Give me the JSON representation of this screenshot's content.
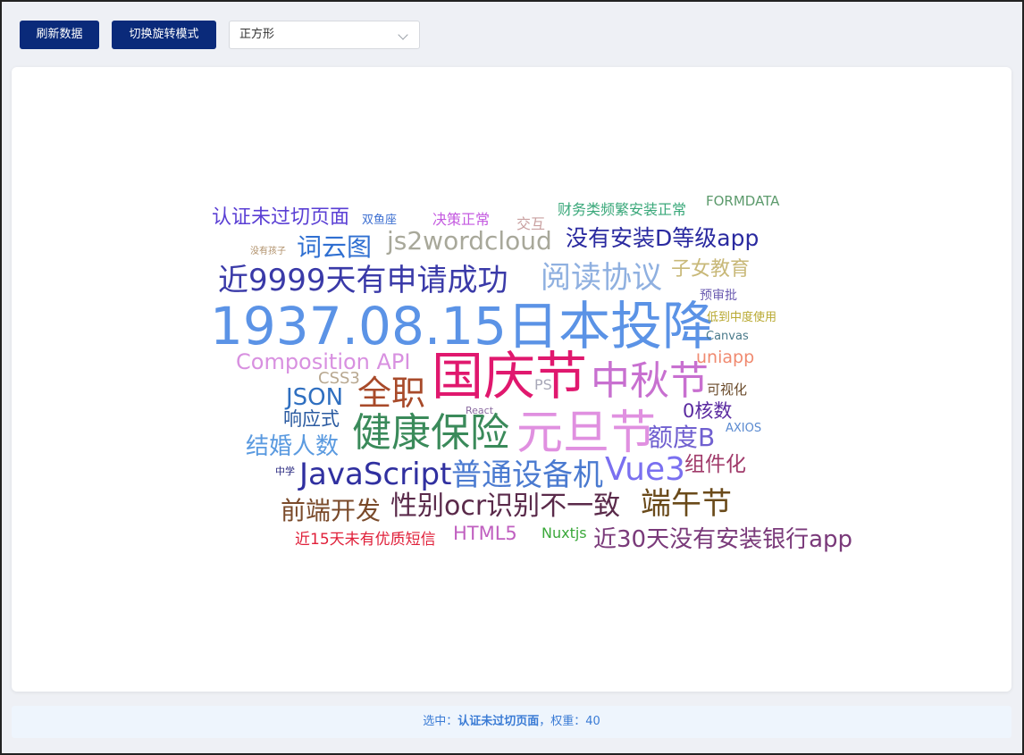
{
  "toolbar": {
    "refresh_label": "刷新数据",
    "rotate_label": "切换旋转模式",
    "shape_select_value": "正方形"
  },
  "status": {
    "prefix": "选中：",
    "selected_word": "认证未过切页面",
    "sep": "，权重：",
    "weight": "40"
  },
  "wordcloud": {
    "words": [
      {
        "text": "认证未过切页面",
        "color": "#5a3fd4"
      },
      {
        "text": "双鱼座",
        "color": "#3d6fd1"
      },
      {
        "text": "决策正常",
        "color": "#c45ae0"
      },
      {
        "text": "交互",
        "color": "#c9a0a0"
      },
      {
        "text": "财务类频繁安装正常",
        "color": "#3aa87a"
      },
      {
        "text": "FORMDATA",
        "color": "#5c9a6c"
      },
      {
        "text": "没有孩子",
        "color": "#b0906a"
      },
      {
        "text": "词云图",
        "color": "#2f6fd1"
      },
      {
        "text": "js2wordcloud",
        "color": "#a8a89a"
      },
      {
        "text": "没有安装D等级app",
        "color": "#2a2aa0"
      },
      {
        "text": "近9999天有申请成功",
        "color": "#3a3aa8"
      },
      {
        "text": "阅读协议",
        "color": "#8fb0e0"
      },
      {
        "text": "子女教育",
        "color": "#c8b878"
      },
      {
        "text": "预审批",
        "color": "#6a5ab0"
      },
      {
        "text": "1937.08.15日本投降",
        "color": "#5b93e6"
      },
      {
        "text": "低到中度使用",
        "color": "#b8a830"
      },
      {
        "text": "Canvas",
        "color": "#4a7a8a"
      },
      {
        "text": "Composition API",
        "color": "#d890e0"
      },
      {
        "text": "国庆节",
        "color": "#e0186e"
      },
      {
        "text": "uniapp",
        "color": "#f08a70"
      },
      {
        "text": "CSS3",
        "color": "#b8a890"
      },
      {
        "text": "PS",
        "color": "#a8a8b8"
      },
      {
        "text": "中秋节",
        "color": "#c870d0"
      },
      {
        "text": "JSON",
        "color": "#2f6fc0"
      },
      {
        "text": "全职",
        "color": "#a84a2a"
      },
      {
        "text": "可视化",
        "color": "#6a4a2a"
      },
      {
        "text": "响应式",
        "color": "#2a5aa0"
      },
      {
        "text": "React",
        "color": "#8a6aa0"
      },
      {
        "text": "0核数",
        "color": "#5a2aa0"
      },
      {
        "text": "健康保险",
        "color": "#3a8a5a"
      },
      {
        "text": "元旦节",
        "color": "#e090e0"
      },
      {
        "text": "结婚人数",
        "color": "#5a9ae0"
      },
      {
        "text": "额度B",
        "color": "#7060d0"
      },
      {
        "text": "AXIOS",
        "color": "#5a8ad0"
      },
      {
        "text": "中学",
        "color": "#2a2a80"
      },
      {
        "text": "JavaScript",
        "color": "#3030a0"
      },
      {
        "text": "普通设备机",
        "color": "#4a7ad0"
      },
      {
        "text": "Vue3",
        "color": "#7a70f0"
      },
      {
        "text": "组件化",
        "color": "#a03a6a"
      },
      {
        "text": "前端开发",
        "color": "#7a4a2a"
      },
      {
        "text": "性别ocr识别不一致",
        "color": "#5a2a4a"
      },
      {
        "text": "端午节",
        "color": "#6a4a1a"
      },
      {
        "text": "近15天未有优质短信",
        "color": "#e0203a"
      },
      {
        "text": "HTML5",
        "color": "#c060c0"
      },
      {
        "text": "Nuxtjs",
        "color": "#3aa83a"
      },
      {
        "text": "近30天没有安装银行app",
        "color": "#7a3a7a"
      }
    ]
  }
}
